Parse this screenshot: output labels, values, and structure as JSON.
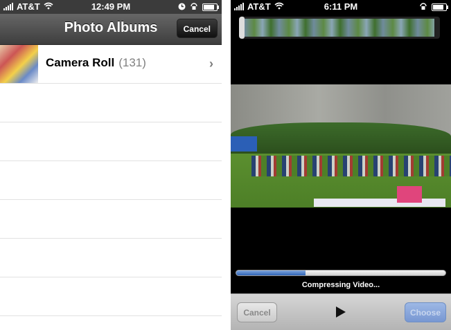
{
  "left": {
    "status": {
      "carrier": "AT&T",
      "time": "12:49 PM"
    },
    "navbar": {
      "title": "Photo Albums",
      "cancel_label": "Cancel"
    },
    "albums": [
      {
        "title": "Camera Roll",
        "count": "(131)"
      }
    ]
  },
  "right": {
    "status": {
      "carrier": "AT&T",
      "time": "6:11 PM"
    },
    "progress": {
      "fraction": 0.33,
      "label": "Compressing Video..."
    },
    "toolbar": {
      "cancel_label": "Cancel",
      "choose_label": "Choose"
    }
  },
  "icons": [
    "signal-bars-icon",
    "wifi-icon",
    "clock-icon",
    "lock-rotation-icon",
    "battery-icon",
    "chevron-right-icon",
    "play-icon"
  ],
  "colors": {
    "navbar_dark": "#3e3e3e",
    "progress_blue": "#2f64b7",
    "choose_blue": "#7897d2"
  }
}
